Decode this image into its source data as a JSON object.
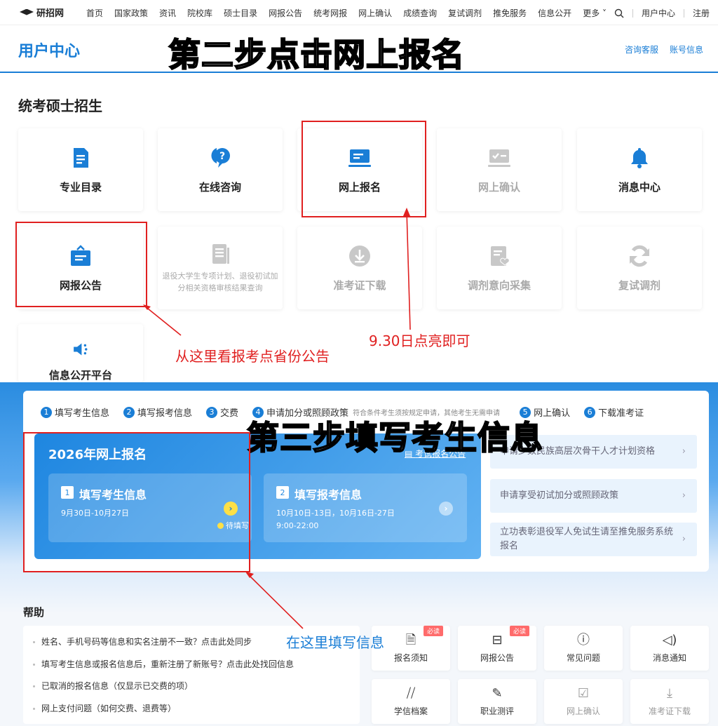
{
  "nav": {
    "logo": "研招网",
    "items": [
      "首页",
      "国家政策",
      "资讯",
      "院校库",
      "硕士目录",
      "网报公告",
      "统考网报",
      "网上确认",
      "成绩查询",
      "复试调剂",
      "推免服务",
      "信息公开"
    ],
    "more": "更多",
    "user_center": "用户中心",
    "register": "注册"
  },
  "header": {
    "title": "用户中心",
    "links": [
      "咨询客服",
      "账号信息"
    ]
  },
  "annotations": {
    "step2": "第二步点击网上报名",
    "step3": "第三步填写考生信息",
    "note_notice": "从这里看报考点省份公告",
    "note_date": "9.30日点亮即可",
    "note_fill": "在这里填写信息"
  },
  "section": {
    "title": "统考硕士招生",
    "tiles": [
      {
        "label": "专业目录",
        "icon": "document-icon",
        "enabled": true
      },
      {
        "label": "在线咨询",
        "icon": "chat-question-icon",
        "enabled": true
      },
      {
        "label": "网上报名",
        "icon": "computer-icon",
        "enabled": true
      },
      {
        "label": "网上确认",
        "icon": "checklist-icon",
        "enabled": false
      },
      {
        "label": "消息中心",
        "icon": "bell-icon",
        "enabled": true
      },
      {
        "label": "网报公告",
        "icon": "notice-bag-icon",
        "enabled": true
      },
      {
        "label": "",
        "icon": "list-doc-icon",
        "enabled": false,
        "sub": "退役大学生专项计划、退役初试加分相关资格审核结果查询"
      },
      {
        "label": "准考证下载",
        "icon": "download-icon",
        "enabled": false
      },
      {
        "label": "调剂意向采集",
        "icon": "form-heart-icon",
        "enabled": false
      },
      {
        "label": "复试调剂",
        "icon": "refresh-icon",
        "enabled": false
      },
      {
        "label": "信息公开平台",
        "icon": "speaker-icon",
        "enabled": true
      }
    ]
  },
  "registration": {
    "steps": [
      {
        "num": "1",
        "label": "填写考生信息"
      },
      {
        "num": "2",
        "label": "填写报考信息"
      },
      {
        "num": "3",
        "label": "交费"
      },
      {
        "num": "4",
        "label": "申请加分或照顾政策"
      },
      {
        "num": "5",
        "label": "网上确认"
      },
      {
        "num": "6",
        "label": "下载准考证"
      }
    ],
    "step4_note": "符合条件考生须按规定申请，其他考生无需申请",
    "title": "2026年网上报名",
    "guide_link": "考试报名公告",
    "box1": {
      "num": "1",
      "title": "填写考生信息",
      "dates": "9月30日-10月27日",
      "status": "待填写"
    },
    "box2": {
      "num": "2",
      "title": "填写报考信息",
      "dates": "10月10日-13日，10月16日-27日",
      "time": "9:00-22:00"
    },
    "side_items": [
      "申请少数民族高层次骨干人才计划资格",
      "申请享受初试加分或照顾政策",
      "立功表彰退役军人免试生请至推免服务系统报名"
    ]
  },
  "help": {
    "title": "帮助",
    "items": [
      "姓名、手机号码等信息和实名注册不一致？点击此处同步",
      "填写考生信息或报名信息后，重新注册了新账号？点击此处找回信息",
      "已取消的报名信息（仅显示已交费的项）",
      "网上支付问题（如何交费、退费等）"
    ],
    "quick": [
      {
        "label": "报名须知",
        "icon": "document-icon",
        "badge": "必读",
        "enabled": true
      },
      {
        "label": "网报公告",
        "icon": "notice-bag-icon",
        "badge": "必读",
        "enabled": true
      },
      {
        "label": "常见问题",
        "icon": "question-icon",
        "badge": "",
        "enabled": true
      },
      {
        "label": "消息通知",
        "icon": "speaker-icon",
        "badge": "",
        "enabled": true
      },
      {
        "label": "学信档案",
        "icon": "book-icon",
        "badge": "",
        "enabled": true
      },
      {
        "label": "职业测评",
        "icon": "evaluation-icon",
        "badge": "",
        "enabled": true
      },
      {
        "label": "网上确认",
        "icon": "checklist-icon",
        "badge": "",
        "enabled": false
      },
      {
        "label": "准考证下载",
        "icon": "download-icon",
        "badge": "",
        "enabled": false
      }
    ]
  },
  "colors": {
    "primary": "#1a7ed6",
    "annotation_red": "#e02020",
    "disabled": "#aaaaaa"
  }
}
